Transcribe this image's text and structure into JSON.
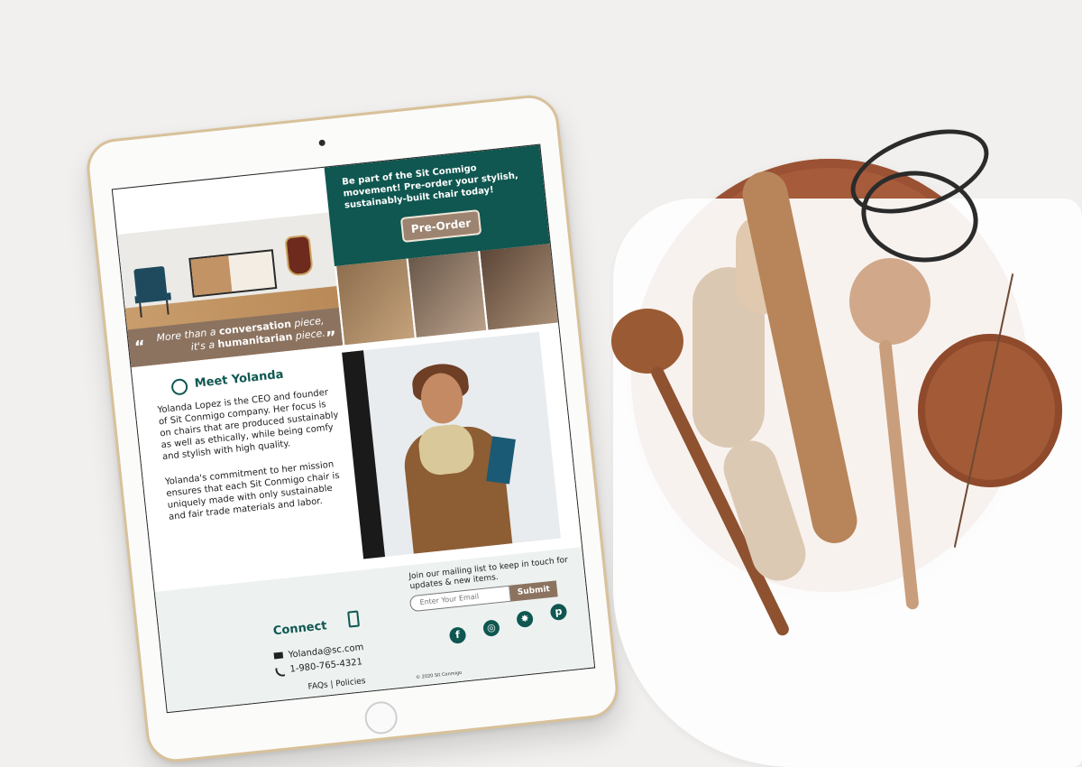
{
  "hero": {
    "quote_prefix": "More than a ",
    "quote_bold1": "conversation",
    "quote_mid": " piece,",
    "quote_line2_prefix": "it's a ",
    "quote_bold2": "humanitarian",
    "quote_suffix": " piece.",
    "open_quote": "“",
    "close_quote": "”",
    "promo_text": "Be part of the Sit Conmigo movement! Pre-order your stylish, sustainably-built chair today!",
    "preorder_label": "Pre-Order"
  },
  "bio": {
    "title": "Meet Yolanda",
    "paragraph1": "Yolanda Lopez is the CEO and founder of Sit Conmigo company. Her focus is on chairs that are produced sustainably as well as ethically, while being comfy and stylish with high quality.",
    "paragraph2": "Yolanda's commitment to her mission ensures that each Sit Conmigo chair is uniquely made with only sustainable and fair trade materials and labor."
  },
  "footer": {
    "mailing_text": "Join our mailing list to keep in touch for updates & new items.",
    "email_placeholder": "Enter Your Email",
    "submit_label": "Submit",
    "connect_title": "Connect",
    "email": "Yolanda@sc.com",
    "phone": "1-980-765-4321",
    "links": "FAQs  |  Policies",
    "copyright": "© 2020 Sit Conmigo",
    "socials": [
      {
        "icon": "facebook-icon",
        "glyph": "f"
      },
      {
        "icon": "instagram-icon",
        "glyph": "◎"
      },
      {
        "icon": "twitter-icon",
        "glyph": "✸"
      },
      {
        "icon": "pinterest-icon",
        "glyph": "p"
      }
    ]
  },
  "colors": {
    "teal": "#0f5750",
    "taupe": "#8c7360",
    "footer_bg": "#edf2f1",
    "tablet_frame": "#d8c19a",
    "wood": "#a65b3a"
  }
}
